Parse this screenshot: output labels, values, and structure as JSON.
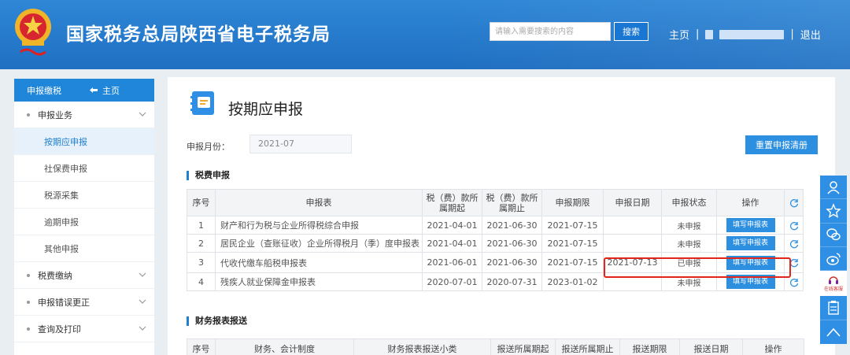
{
  "header": {
    "title": "国家税务总局陕西省电子税务局",
    "search_placeholder": "请输入需要搜索的内容",
    "search_button": "搜索",
    "nav_home": "主页",
    "separator": "|",
    "nav_logout": "退出"
  },
  "sidebar": {
    "head_label": "申报缴税",
    "head_home": "主页",
    "items": [
      {
        "label": "申报业务",
        "type": "group"
      },
      {
        "label": "按期应申报",
        "type": "sub",
        "active": true
      },
      {
        "label": "社保费申报",
        "type": "sub"
      },
      {
        "label": "税源采集",
        "type": "sub"
      },
      {
        "label": "逾期申报",
        "type": "sub"
      },
      {
        "label": "其他申报",
        "type": "sub"
      },
      {
        "label": "税费缴纳",
        "type": "group"
      },
      {
        "label": "申报错误更正",
        "type": "group"
      },
      {
        "label": "查询及打印",
        "type": "group"
      }
    ]
  },
  "main": {
    "page_title": "按期应申报",
    "period_label": "申报月份：",
    "period_value": "2021-07",
    "reset_button": "重置申报清册",
    "tax_section_title": "税费申报",
    "tax_table": {
      "headers": [
        "序号",
        "申报表",
        "税（费）款所属期起",
        "税（费）款所属期止",
        "申报期限",
        "申报日期",
        "申报状态",
        "操作"
      ],
      "rows": [
        {
          "no": "1",
          "form": "财产和行为税与企业所得税综合申报",
          "start": "2021-04-01",
          "end": "2021-06-30",
          "deadline": "2021-07-15",
          "date": "",
          "status": "未申报",
          "action": "填写申报表"
        },
        {
          "no": "2",
          "form": "居民企业（查账征收）企业所得税月（季）度申报表",
          "start": "2021-04-01",
          "end": "2021-06-30",
          "deadline": "2021-07-15",
          "date": "",
          "status": "未申报",
          "action": "填写申报表"
        },
        {
          "no": "3",
          "form": "代收代缴车船税申报表",
          "start": "2021-06-01",
          "end": "2021-06-30",
          "deadline": "2021-07-15",
          "date": "2021-07-13",
          "status": "已申报",
          "action": "填写申报表"
        },
        {
          "no": "4",
          "form": "残疾人就业保障金申报表",
          "start": "2020-07-01",
          "end": "2020-07-31",
          "deadline": "2023-01-02",
          "date": "",
          "status": "未申报",
          "action": "填写申报表"
        }
      ]
    },
    "finance_section_title": "财务报表报送",
    "finance_table": {
      "headers": [
        "序号",
        "财务、会计制度",
        "财务报表报送小类",
        "报送所属期起",
        "报送所属期止",
        "报送期限",
        "报送日期",
        "操作"
      ]
    }
  },
  "floating_toolbar": {
    "kefu_label": "在线客服"
  },
  "colors": {
    "header_blue": "#1f6fc2",
    "primary_button": "#2c8fe0",
    "highlight_red": "#e3241b"
  }
}
